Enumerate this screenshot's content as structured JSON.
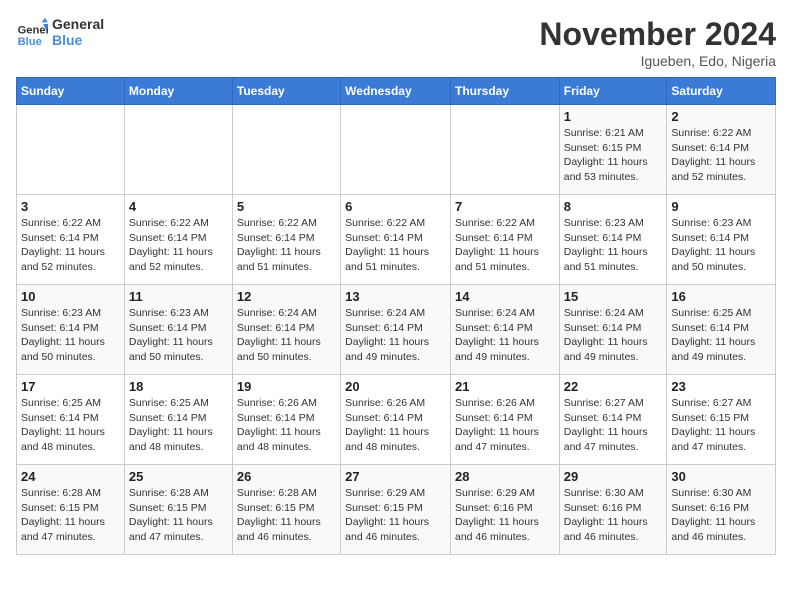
{
  "logo": {
    "line1": "General",
    "line2": "Blue"
  },
  "title": "November 2024",
  "location": "Igueben, Edo, Nigeria",
  "weekdays": [
    "Sunday",
    "Monday",
    "Tuesday",
    "Wednesday",
    "Thursday",
    "Friday",
    "Saturday"
  ],
  "weeks": [
    [
      {
        "day": "",
        "info": ""
      },
      {
        "day": "",
        "info": ""
      },
      {
        "day": "",
        "info": ""
      },
      {
        "day": "",
        "info": ""
      },
      {
        "day": "",
        "info": ""
      },
      {
        "day": "1",
        "info": "Sunrise: 6:21 AM\nSunset: 6:15 PM\nDaylight: 11 hours\nand 53 minutes."
      },
      {
        "day": "2",
        "info": "Sunrise: 6:22 AM\nSunset: 6:14 PM\nDaylight: 11 hours\nand 52 minutes."
      }
    ],
    [
      {
        "day": "3",
        "info": "Sunrise: 6:22 AM\nSunset: 6:14 PM\nDaylight: 11 hours\nand 52 minutes."
      },
      {
        "day": "4",
        "info": "Sunrise: 6:22 AM\nSunset: 6:14 PM\nDaylight: 11 hours\nand 52 minutes."
      },
      {
        "day": "5",
        "info": "Sunrise: 6:22 AM\nSunset: 6:14 PM\nDaylight: 11 hours\nand 51 minutes."
      },
      {
        "day": "6",
        "info": "Sunrise: 6:22 AM\nSunset: 6:14 PM\nDaylight: 11 hours\nand 51 minutes."
      },
      {
        "day": "7",
        "info": "Sunrise: 6:22 AM\nSunset: 6:14 PM\nDaylight: 11 hours\nand 51 minutes."
      },
      {
        "day": "8",
        "info": "Sunrise: 6:23 AM\nSunset: 6:14 PM\nDaylight: 11 hours\nand 51 minutes."
      },
      {
        "day": "9",
        "info": "Sunrise: 6:23 AM\nSunset: 6:14 PM\nDaylight: 11 hours\nand 50 minutes."
      }
    ],
    [
      {
        "day": "10",
        "info": "Sunrise: 6:23 AM\nSunset: 6:14 PM\nDaylight: 11 hours\nand 50 minutes."
      },
      {
        "day": "11",
        "info": "Sunrise: 6:23 AM\nSunset: 6:14 PM\nDaylight: 11 hours\nand 50 minutes."
      },
      {
        "day": "12",
        "info": "Sunrise: 6:24 AM\nSunset: 6:14 PM\nDaylight: 11 hours\nand 50 minutes."
      },
      {
        "day": "13",
        "info": "Sunrise: 6:24 AM\nSunset: 6:14 PM\nDaylight: 11 hours\nand 49 minutes."
      },
      {
        "day": "14",
        "info": "Sunrise: 6:24 AM\nSunset: 6:14 PM\nDaylight: 11 hours\nand 49 minutes."
      },
      {
        "day": "15",
        "info": "Sunrise: 6:24 AM\nSunset: 6:14 PM\nDaylight: 11 hours\nand 49 minutes."
      },
      {
        "day": "16",
        "info": "Sunrise: 6:25 AM\nSunset: 6:14 PM\nDaylight: 11 hours\nand 49 minutes."
      }
    ],
    [
      {
        "day": "17",
        "info": "Sunrise: 6:25 AM\nSunset: 6:14 PM\nDaylight: 11 hours\nand 48 minutes."
      },
      {
        "day": "18",
        "info": "Sunrise: 6:25 AM\nSunset: 6:14 PM\nDaylight: 11 hours\nand 48 minutes."
      },
      {
        "day": "19",
        "info": "Sunrise: 6:26 AM\nSunset: 6:14 PM\nDaylight: 11 hours\nand 48 minutes."
      },
      {
        "day": "20",
        "info": "Sunrise: 6:26 AM\nSunset: 6:14 PM\nDaylight: 11 hours\nand 48 minutes."
      },
      {
        "day": "21",
        "info": "Sunrise: 6:26 AM\nSunset: 6:14 PM\nDaylight: 11 hours\nand 47 minutes."
      },
      {
        "day": "22",
        "info": "Sunrise: 6:27 AM\nSunset: 6:14 PM\nDaylight: 11 hours\nand 47 minutes."
      },
      {
        "day": "23",
        "info": "Sunrise: 6:27 AM\nSunset: 6:15 PM\nDaylight: 11 hours\nand 47 minutes."
      }
    ],
    [
      {
        "day": "24",
        "info": "Sunrise: 6:28 AM\nSunset: 6:15 PM\nDaylight: 11 hours\nand 47 minutes."
      },
      {
        "day": "25",
        "info": "Sunrise: 6:28 AM\nSunset: 6:15 PM\nDaylight: 11 hours\nand 47 minutes."
      },
      {
        "day": "26",
        "info": "Sunrise: 6:28 AM\nSunset: 6:15 PM\nDaylight: 11 hours\nand 46 minutes."
      },
      {
        "day": "27",
        "info": "Sunrise: 6:29 AM\nSunset: 6:15 PM\nDaylight: 11 hours\nand 46 minutes."
      },
      {
        "day": "28",
        "info": "Sunrise: 6:29 AM\nSunset: 6:16 PM\nDaylight: 11 hours\nand 46 minutes."
      },
      {
        "day": "29",
        "info": "Sunrise: 6:30 AM\nSunset: 6:16 PM\nDaylight: 11 hours\nand 46 minutes."
      },
      {
        "day": "30",
        "info": "Sunrise: 6:30 AM\nSunset: 6:16 PM\nDaylight: 11 hours\nand 46 minutes."
      }
    ]
  ]
}
